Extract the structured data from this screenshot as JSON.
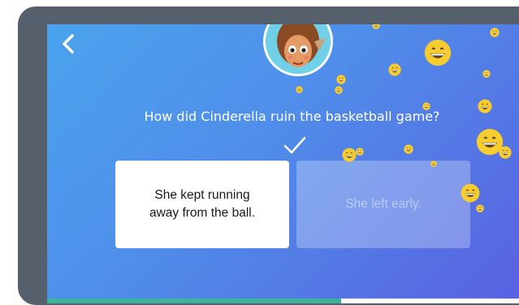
{
  "quiz": {
    "question": "How did Cinderella ruin the basketball game?",
    "answers": [
      {
        "label": "She kept running away from the ball.",
        "state": "selected"
      },
      {
        "label": "She left early.",
        "state": "disabled"
      }
    ],
    "progress": 0.6
  },
  "icons": {
    "back": "chevron-left-icon",
    "check": "checkmark-icon",
    "reaction": "grinning-face-emoji"
  },
  "colors": {
    "background_start": "#4aa3ee",
    "background_end": "#5a5fe0",
    "progress": "#3cb39a",
    "emoji": "#f7cc2f"
  }
}
